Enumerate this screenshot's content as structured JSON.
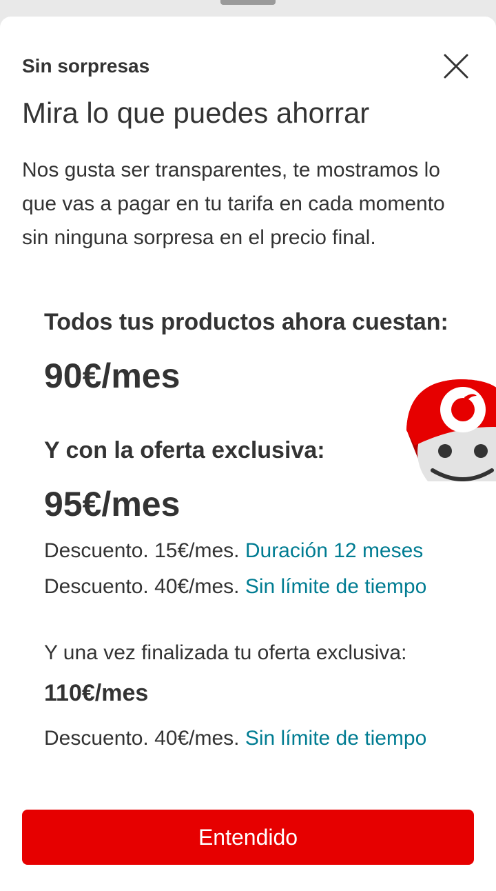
{
  "header": {
    "subtitle": "Sin sorpresas",
    "close_icon": "close-icon"
  },
  "main": {
    "title": "Mira lo que puedes ahorrar",
    "intro": "Nos gusta ser transparentes, te mostramos lo que vas a pagar en tu tarifa en cada momento sin ninguna sorpresa en el precio final.",
    "current": {
      "label": "Todos tus productos ahora cuestan:",
      "price": "90€/mes"
    },
    "offer": {
      "label": "Y con la oferta exclusiva:",
      "price": "95€/mes",
      "discounts": [
        {
          "text": "Descuento. 15€/mes.",
          "duration": "Duración 12 meses"
        },
        {
          "text": "Descuento. 40€/mes.",
          "duration": "Sin límite de tiempo"
        }
      ]
    },
    "after": {
      "label": "Y una vez finalizada tu oferta exclusiva:",
      "price": "110€/mes",
      "discounts": [
        {
          "text": "Descuento. 40€/mes.",
          "duration": "Sin límite de tiempo"
        }
      ]
    }
  },
  "footer": {
    "cta_label": "Entendido"
  },
  "colors": {
    "brand_red": "#e60000",
    "link_teal": "#007c92",
    "text": "#333333"
  },
  "icons": {
    "mascot": "vodafone-tobi-mascot-icon"
  }
}
